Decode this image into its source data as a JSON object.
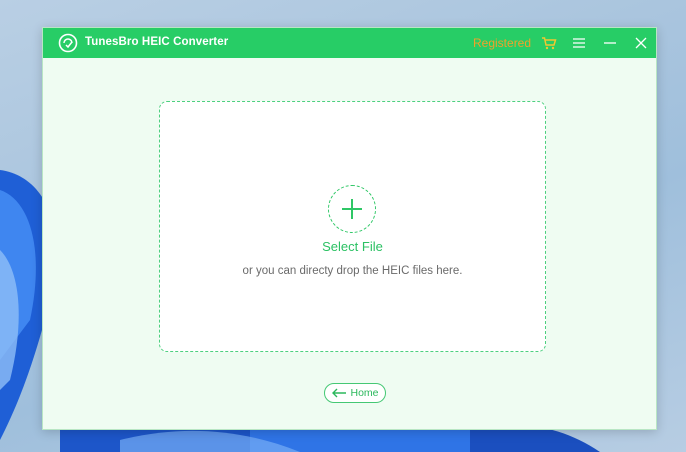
{
  "window": {
    "title": "TunesBro HEIC Converter",
    "registered_label": "Registered"
  },
  "icons": {
    "logo": "app-logo-icon",
    "cart": "cart-icon",
    "menu": "hamburger-menu-icon",
    "minimize": "minimize-icon",
    "close": "close-icon",
    "plus": "plus-icon",
    "back_arrow": "arrow-left-icon"
  },
  "dropzone": {
    "select_label": "Select File",
    "hint": "or you can directy drop the HEIC files here."
  },
  "footer": {
    "home_label": "Home"
  },
  "colors": {
    "titlebar": "#27cd66",
    "registered": "#f0a12a",
    "accent": "#2bc163",
    "window_bg": "#effcf2"
  }
}
